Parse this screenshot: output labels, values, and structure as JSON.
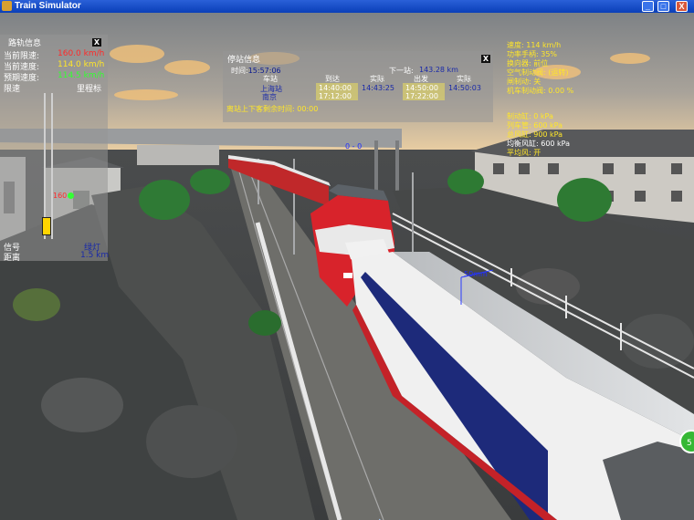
{
  "window": {
    "title": "Train Simulator",
    "minimize": "_",
    "maximize": "□",
    "close": "X"
  },
  "track_panel": {
    "title": "路轨信息",
    "close": "X",
    "limit_label": "当前限速:",
    "limit_value": "160.0 km/h",
    "speed_label": "当前速度:",
    "speed_value": "114.0 km/h",
    "pred_label": "预期速度:",
    "pred_value": "114.5 km/h",
    "limit2_label": "限速",
    "mileage_label": "里程标",
    "speed_marker": "160",
    "signal_label": "信号",
    "signal_value": "绿灯",
    "dist_label": "距离",
    "dist_value": "1.5 km"
  },
  "station_panel": {
    "title": "停站信息",
    "close": "X",
    "time_label": "时间:",
    "time_value": "15:57:06",
    "next_label": "下一站:",
    "next_value": "143.28 km",
    "headers": [
      "车站",
      "到达",
      "实际",
      "出发",
      "实际"
    ],
    "rows": [
      {
        "station": "上海站",
        "arrive": "14:40:00",
        "actual_arrive": "14:43:25",
        "depart": "14:50:00",
        "actual_depart": "14:50:03"
      },
      {
        "station": "南京",
        "arrive": "17:12:00",
        "actual_arrive": "",
        "depart": "17:22:00",
        "actual_depart": ""
      }
    ],
    "status": "离站上下客剩余时间: 00:00"
  },
  "hud": {
    "lines": [
      "速度: 114 km/h",
      "功率手柄: 35%",
      "换向器: 前位",
      "空气制动阀: (运转)",
      "闸制动: 关",
      "机车制动阀: 0.00 %"
    ],
    "pressure_lines": [
      "制动缸: 0 kPa",
      "列车管: 600 kPa",
      "总风缸: 900 kPa",
      "均衡风缸: 600 kPa",
      "平均风: 开"
    ]
  },
  "scene": {
    "distance_counter": "0 - 0",
    "marker": "50mm",
    "side_button": "5"
  }
}
